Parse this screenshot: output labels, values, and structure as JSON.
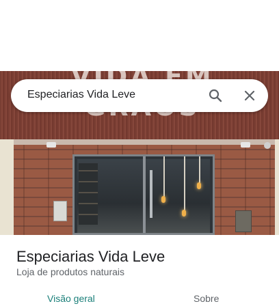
{
  "search": {
    "query": "Especiarias Vida Leve",
    "search_icon": "search-icon",
    "close_icon": "close-icon"
  },
  "photo": {
    "sign_text": "VIDA EM GRÃOS"
  },
  "place": {
    "name": "Especiarias Vida Leve",
    "category": "Loja de produtos naturais"
  },
  "tabs": [
    {
      "label": "Visão geral",
      "selected": true
    },
    {
      "label": "Sobre",
      "selected": false
    }
  ],
  "colors": {
    "accent": "#1a7f79",
    "text_primary": "#202124",
    "text_secondary": "#5f6368"
  }
}
